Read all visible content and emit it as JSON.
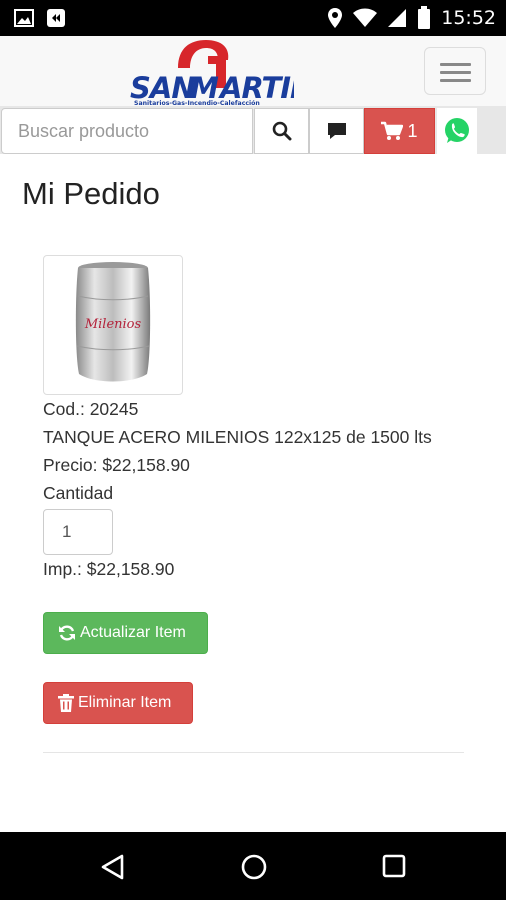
{
  "status_bar": {
    "time": "15:52"
  },
  "header": {
    "logo_text": "SANMARTIN",
    "logo_tagline": "Sanitarios-Gas-Incendio-Calefacción"
  },
  "search": {
    "placeholder": "Buscar producto",
    "cart_count": "1"
  },
  "page": {
    "title": "Mi Pedido"
  },
  "item": {
    "code": "Cod.: 20245",
    "name": "TANQUE ACERO MILENIOS 122x125 de 1500 lts",
    "price": "Precio: $22,158.90",
    "quantity_label": "Cantidad",
    "quantity_value": "1",
    "amount": "Imp.: $22,158.90",
    "image_label": "Milenios"
  },
  "actions": {
    "update_label": "Actualizar Item",
    "delete_label": "Eliminar Item"
  },
  "colors": {
    "danger": "#d9534f",
    "success": "#5cb85c",
    "whatsapp": "#25d366",
    "brand_blue": "#1a3d9c",
    "brand_red": "#d7262b"
  }
}
